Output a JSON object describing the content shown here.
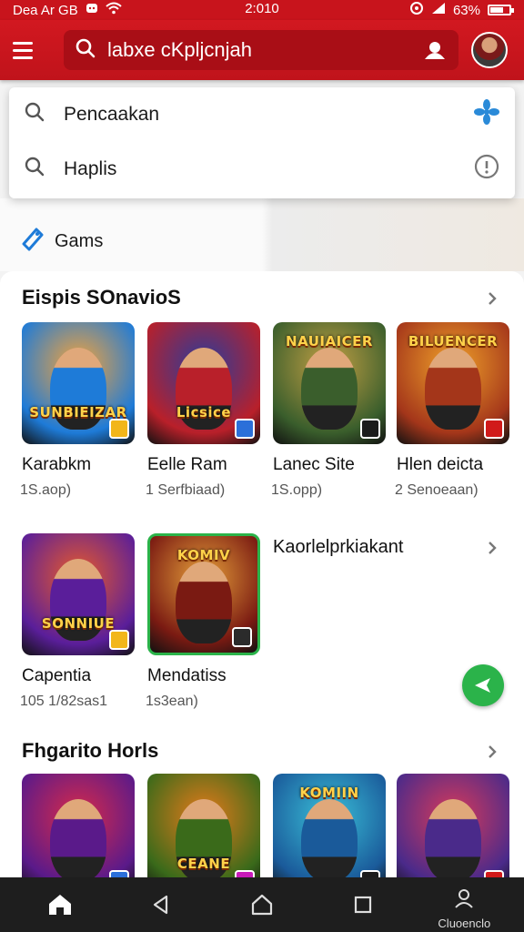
{
  "status_bar": {
    "left_text": "Dea Ar GB",
    "time": "2:010",
    "battery": "63%",
    "battery_level": 0.63
  },
  "search": {
    "query": "labxe cKpljcnjah"
  },
  "suggestions": [
    {
      "text": "Pencaakan",
      "leading_icon": "search-icon",
      "trailing_icon": "fan-icon"
    },
    {
      "text": "Haplis",
      "leading_icon": "search-icon",
      "trailing_icon": "info-icon"
    }
  ],
  "games_link": {
    "label": "Gams",
    "icon": "tag-icon"
  },
  "sections": [
    {
      "title": "Eispis SOnavioS"
    },
    {
      "title": "Kaorlelprkiakant"
    },
    {
      "title": "Fhgarito Horls"
    }
  ],
  "apps_row1": [
    {
      "name": "Karabkm",
      "meta": "1S.aop)",
      "art_title": "SUNBIEIZAR",
      "colors": [
        "#1e7bd8",
        "#f5a33a"
      ],
      "badge": "#f2b61a"
    },
    {
      "name": "Eelle Ram",
      "meta": "1 Serfbiaad)",
      "art_title": "Licsice",
      "colors": [
        "#b9202a",
        "#2a3c9c"
      ],
      "badge": "#2b6fd9"
    },
    {
      "name": "Lanec Site",
      "meta": "1S.opp)",
      "art_title": "NAUIAICER",
      "colors": [
        "#3a5e2c",
        "#c3a044"
      ],
      "badge": "#1b1b1b"
    },
    {
      "name": "Hlen deicta",
      "meta": "2 Senoeaan)",
      "art_title": "BILUENCER",
      "colors": [
        "#a4361a",
        "#f0a22a"
      ],
      "badge": "#d11a1a"
    }
  ],
  "apps_row2": [
    {
      "name": "Capentia",
      "meta": "105 1/82sas1",
      "art_title": "SONNIUE",
      "colors": [
        "#5a1e9a",
        "#e85a2a"
      ],
      "badge": "#f2b61a"
    },
    {
      "name": "Mendatiss",
      "meta": "1s3ean)",
      "art_title": "KOMIV",
      "colors": [
        "#7a1a12",
        "#e6a03a"
      ],
      "badge": "#2b2b2b"
    }
  ],
  "apps_row3": [
    {
      "art_title": "",
      "colors": [
        "#5a1a8a",
        "#d82a4a"
      ],
      "badge": "#2b6fd9"
    },
    {
      "art_title": "CEANE",
      "colors": [
        "#3a6a1a",
        "#e67a1a"
      ],
      "badge": "#c81ab9"
    },
    {
      "art_title": "KOMIIN",
      "colors": [
        "#1a5a9a",
        "#3ac0d8"
      ],
      "badge": "#1b1b1b"
    },
    {
      "art_title": "",
      "colors": [
        "#4a2a8a",
        "#d83a5a"
      ],
      "badge": "#d11a1a"
    }
  ],
  "nav": {
    "profile_label": "Cluoenclo"
  },
  "colors": {
    "brand": "#c8141c",
    "fab": "#2bb34a"
  }
}
